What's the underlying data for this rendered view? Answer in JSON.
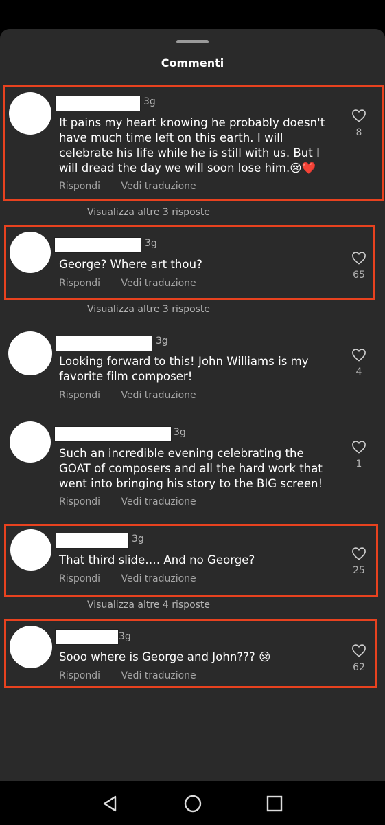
{
  "sheet": {
    "title": "Commenti"
  },
  "comments": [
    {
      "time": "3g",
      "text": "It pains my heart knowing he probably doesn't have much time left on this earth. I will celebrate his life while he is still with us. But I will dread the day we will soon lose him.😢❤️",
      "reply_label": "Rispondi",
      "translate_label": "Vedi traduzione",
      "likes": "8",
      "more_replies": "Visualizza altre 3 risposte"
    },
    {
      "time": "3g",
      "text": "George? Where art thou?",
      "reply_label": "Rispondi",
      "translate_label": "Vedi traduzione",
      "likes": "65",
      "more_replies": "Visualizza altre 3 risposte"
    },
    {
      "time": "3g",
      "text": "Looking forward to this! John Williams is my favorite film composer!",
      "reply_label": "Rispondi",
      "translate_label": "Vedi traduzione",
      "likes": "4"
    },
    {
      "time": "3g",
      "text": "Such an incredible evening celebrating the GOAT of composers and all the hard work that went into bringing his story to the BIG screen!",
      "reply_label": "Rispondi",
      "translate_label": "Vedi traduzione",
      "likes": "1"
    },
    {
      "time": "3g",
      "text": "That third slide…. And no George?",
      "reply_label": "Rispondi",
      "translate_label": "Vedi traduzione",
      "likes": "25",
      "more_replies": "Visualizza altre 4 risposte"
    },
    {
      "time": "3g",
      "text": "Sooo where is George and John??? 😢",
      "reply_label": "Rispondi",
      "translate_label": "Vedi traduzione",
      "likes": "62"
    }
  ],
  "icons": {
    "like": "heart-outline-icon",
    "nav_back": "triangle-back-icon",
    "nav_home": "circle-home-icon",
    "nav_recents": "square-recents-icon"
  },
  "colors": {
    "highlight": "#e8421f",
    "sheet_background": "#2a2a2a",
    "secondary_text": "#a6a6a6"
  }
}
